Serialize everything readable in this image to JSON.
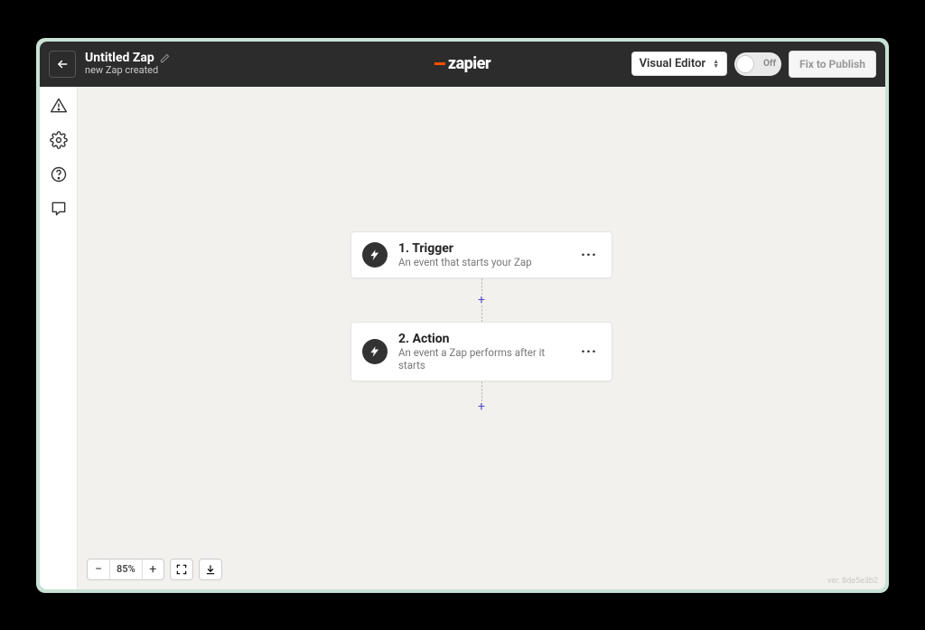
{
  "header": {
    "title": "Untitled Zap",
    "subtitle": "new Zap created",
    "brand": "zapier",
    "view_selector_label": "Visual Editor",
    "toggle_label": "Off",
    "publish_label": "Fix to Publish"
  },
  "sidebar_icons": {
    "0": "warning-icon",
    "1": "gear-icon",
    "2": "help-icon",
    "3": "comment-icon"
  },
  "steps": [
    {
      "title": "1. Trigger",
      "subtitle": "An event that starts your Zap"
    },
    {
      "title": "2. Action",
      "subtitle": "An event a Zap performs after it starts"
    }
  ],
  "zoom": {
    "level": "85%"
  },
  "version": "ver. 8de5e3b2"
}
